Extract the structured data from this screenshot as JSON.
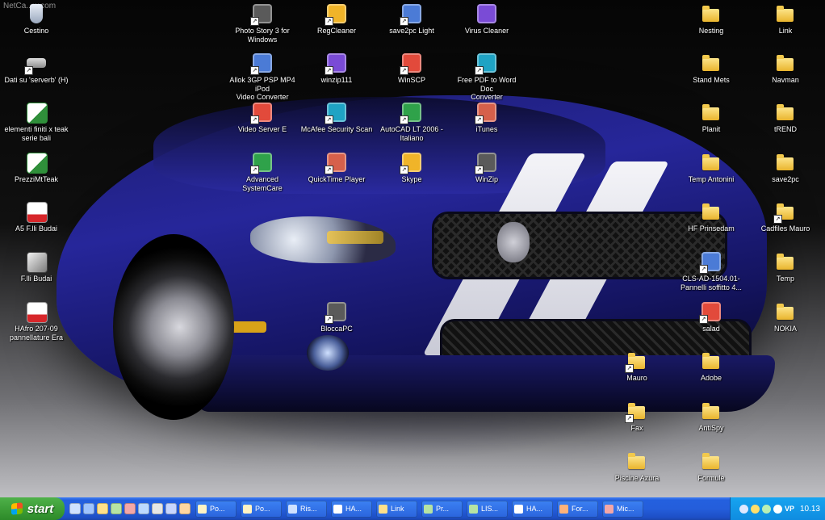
{
  "watermark": "NetCa...w.com",
  "desktop_icons": [
    {
      "id": "cestino",
      "label": "Cestino",
      "kind": "recycle-bin"
    },
    {
      "id": "dati-serverb",
      "label": "Dati su 'serverb' (H)",
      "kind": "network-drive"
    },
    {
      "id": "elementi-finiti",
      "label": "elementi finiti x teak\nserie bali",
      "kind": "excel"
    },
    {
      "id": "prezzimtteak",
      "label": "PrezziMtTeak",
      "kind": "excel"
    },
    {
      "id": "a5-flli-budai",
      "label": "A5 F.lli Budai",
      "kind": "pdf"
    },
    {
      "id": "flli-budai",
      "label": "F.lli Budai",
      "kind": "nx"
    },
    {
      "id": "hafro",
      "label": "HAfro 207-09\npannellature Era",
      "kind": "pdf"
    },
    {
      "id": "photo-story",
      "label": "Photo Story 3 for\nWindows",
      "kind": "app"
    },
    {
      "id": "allok",
      "label": "Allok 3GP PSP MP4 iPod\nVideo Converter",
      "kind": "app"
    },
    {
      "id": "video-server",
      "label": "Video Server E",
      "kind": "app"
    },
    {
      "id": "advanced-systemcare",
      "label": "Advanced SystemCare",
      "kind": "app"
    },
    {
      "id": "regcleaner",
      "label": "RegCleaner",
      "kind": "app"
    },
    {
      "id": "winzip111",
      "label": "winzip111",
      "kind": "app"
    },
    {
      "id": "mcafee",
      "label": "McAfee Security Scan",
      "kind": "app"
    },
    {
      "id": "quicktime",
      "label": "QuickTime Player",
      "kind": "app"
    },
    {
      "id": "bloccapc",
      "label": "BloccaPC",
      "kind": "app"
    },
    {
      "id": "save2pc-light",
      "label": "save2pc Light",
      "kind": "app"
    },
    {
      "id": "winscp",
      "label": "WinSCP",
      "kind": "app"
    },
    {
      "id": "autocad",
      "label": "AutoCAD LT 2006 -\nItaliano",
      "kind": "app"
    },
    {
      "id": "skype",
      "label": "Skype",
      "kind": "app"
    },
    {
      "id": "virus-cleaner",
      "label": "Virus Cleaner",
      "kind": "app"
    },
    {
      "id": "free-pdf-word",
      "label": "Free PDF to Word Doc\nConverter",
      "kind": "app"
    },
    {
      "id": "itunes",
      "label": "iTunes",
      "kind": "app"
    },
    {
      "id": "winzip",
      "label": "WinZip",
      "kind": "app"
    },
    {
      "id": "mauro",
      "label": "Mauro",
      "kind": "folder"
    },
    {
      "id": "fax",
      "label": "Fax",
      "kind": "folder"
    },
    {
      "id": "piscine-azura",
      "label": "Piscine Azura",
      "kind": "folder"
    },
    {
      "id": "nesting",
      "label": "Nesting",
      "kind": "folder"
    },
    {
      "id": "stand-mets",
      "label": "Stand Mets",
      "kind": "folder"
    },
    {
      "id": "planit",
      "label": "Planit",
      "kind": "folder"
    },
    {
      "id": "temp-antonini",
      "label": "Temp Antonini",
      "kind": "folder"
    },
    {
      "id": "hf-prinsedam",
      "label": "HF Prinsedam",
      "kind": "folder"
    },
    {
      "id": "cls",
      "label": "CLS-AD-1504.01-\nPannelli soffitto 4...",
      "kind": "app"
    },
    {
      "id": "salad",
      "label": "salad",
      "kind": "app"
    },
    {
      "id": "adobe",
      "label": "Adobe",
      "kind": "folder"
    },
    {
      "id": "antispy",
      "label": "AntiSpy",
      "kind": "folder"
    },
    {
      "id": "formule",
      "label": "Formule",
      "kind": "folder"
    },
    {
      "id": "link",
      "label": "Link",
      "kind": "folder"
    },
    {
      "id": "navman",
      "label": "Navman",
      "kind": "folder"
    },
    {
      "id": "trend",
      "label": "tREND",
      "kind": "folder"
    },
    {
      "id": "save2pc",
      "label": "save2pc",
      "kind": "folder"
    },
    {
      "id": "cadfiles-mauro",
      "label": "Cadfiles Mauro",
      "kind": "folder"
    },
    {
      "id": "temp",
      "label": "Temp",
      "kind": "folder"
    },
    {
      "id": "nokia",
      "label": "NOKIA",
      "kind": "folder"
    }
  ],
  "taskbar": {
    "start_label": "start",
    "tasks": [
      {
        "label": "Po..."
      },
      {
        "label": "Po..."
      },
      {
        "label": "Ris..."
      },
      {
        "label": "HA..."
      },
      {
        "label": "Link"
      },
      {
        "label": "Pr..."
      },
      {
        "label": "LIS..."
      },
      {
        "label": "HA..."
      },
      {
        "label": "For..."
      },
      {
        "label": "Mic..."
      }
    ],
    "tray_text": "VP",
    "clock": "10.13"
  },
  "colors": {
    "taskbar_blue": "#245edb",
    "start_green": "#3a9a35",
    "tray_blue": "#0f8ce0",
    "folder_yellow": "#f2c94c"
  }
}
